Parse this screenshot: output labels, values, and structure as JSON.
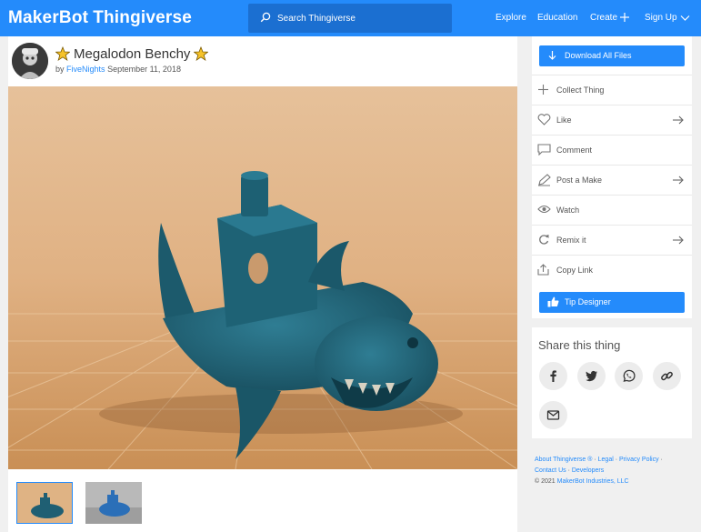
{
  "header": {
    "logo_part1": "MakerBot",
    "logo_part2": "Thingiverse",
    "search_placeholder": "Search Thingiverse",
    "nav": {
      "explore": "Explore",
      "education": "Education",
      "create": "Create",
      "signup": "Sign Up"
    }
  },
  "thing": {
    "title": "Megalodon Benchy",
    "by": "by",
    "author": "FiveNights",
    "date": "September 11, 2018",
    "thumbnail_count": 2
  },
  "sidebar": {
    "download": "Download All Files",
    "actions": {
      "collect": "Collect Thing",
      "like": "Like",
      "comment": "Comment",
      "post_make": "Post a Make",
      "watch": "Watch",
      "remix": "Remix it",
      "copy_link": "Copy Link"
    },
    "tip": "Tip Designer"
  },
  "share": {
    "title": "Share this thing",
    "icons": [
      "facebook-icon",
      "twitter-icon",
      "whatsapp-icon",
      "link-icon",
      "email-icon"
    ]
  },
  "footer": {
    "about": "About Thingiverse ®",
    "sep1": " · ",
    "legal": "Legal",
    "sep2": " · ",
    "privacy": "Privacy Policy",
    "sep3": " · ",
    "contact": "Contact Us",
    "sep4": " · ",
    "developers": "Developers",
    "copyright_prefix": "© 2021 ",
    "company": "MakerBot Industries, LLC"
  },
  "colors": {
    "brand": "#248bfb",
    "search_bg": "#1b6fd1",
    "page_bg": "#f0f0f0",
    "model": "#1f5f73",
    "backdrop": "#e2b98a"
  }
}
